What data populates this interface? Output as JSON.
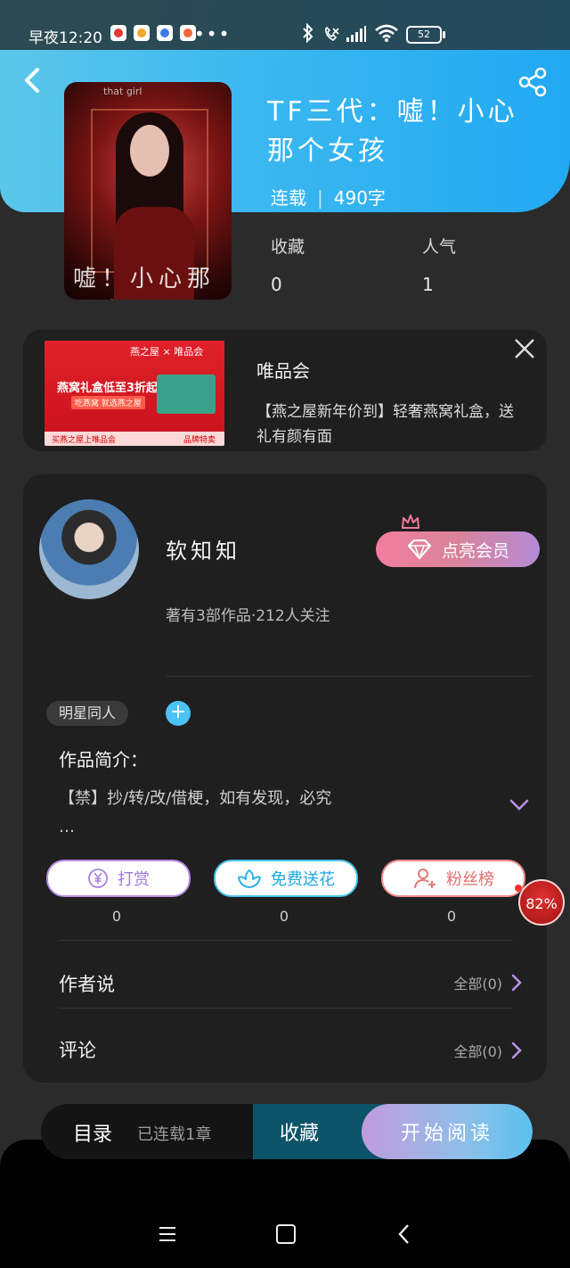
{
  "status_bar": {
    "time": "早夜12:20",
    "battery": "52"
  },
  "book": {
    "title": "TF三代：嘘！小心那个女孩",
    "status": "连载",
    "word_count": "490字",
    "cover_text": "嘘！小心那个女孩",
    "cover_top": "that girl",
    "stats": {
      "favorites_label": "收藏",
      "favorites_value": "0",
      "popularity_label": "人气",
      "popularity_value": "1"
    }
  },
  "ad": {
    "title": "唯品会",
    "text": "【燕之屋新年价到】轻奢燕窝礼盒，送礼有颜有面",
    "image_head": "燕之屋 × 唯品会",
    "image_big": "燕窝礼盒低至3折起",
    "image_small": "吃燕窝 就选燕之屋",
    "image_bottom_left": "买燕之屋上唯品会",
    "image_bottom_right": "品牌特卖"
  },
  "author": {
    "name": "软知知",
    "vip_button": "点亮会员",
    "meta": "著有3部作品·212人关注"
  },
  "work": {
    "tag": "明星同人",
    "plus": "+",
    "intro_title": "作品简介：",
    "intro_text": "【禁】抄/转/改/借梗，如有发现，必究",
    "intro_more": "…"
  },
  "actions": {
    "reward_label": "打赏",
    "reward_count": "0",
    "flower_label": "免费送花",
    "flower_count": "0",
    "fans_label": "粉丝榜",
    "fans_count": "0"
  },
  "progress": "82%",
  "rows": {
    "author_says": "作者说",
    "author_says_right": "全部(0)",
    "comments": "评论",
    "comments_right": "全部(0)"
  },
  "bottom_bar": {
    "toc": "目录",
    "toc_sub": "已连载1章",
    "favorite": "收藏",
    "start_reading": "开始阅读"
  }
}
